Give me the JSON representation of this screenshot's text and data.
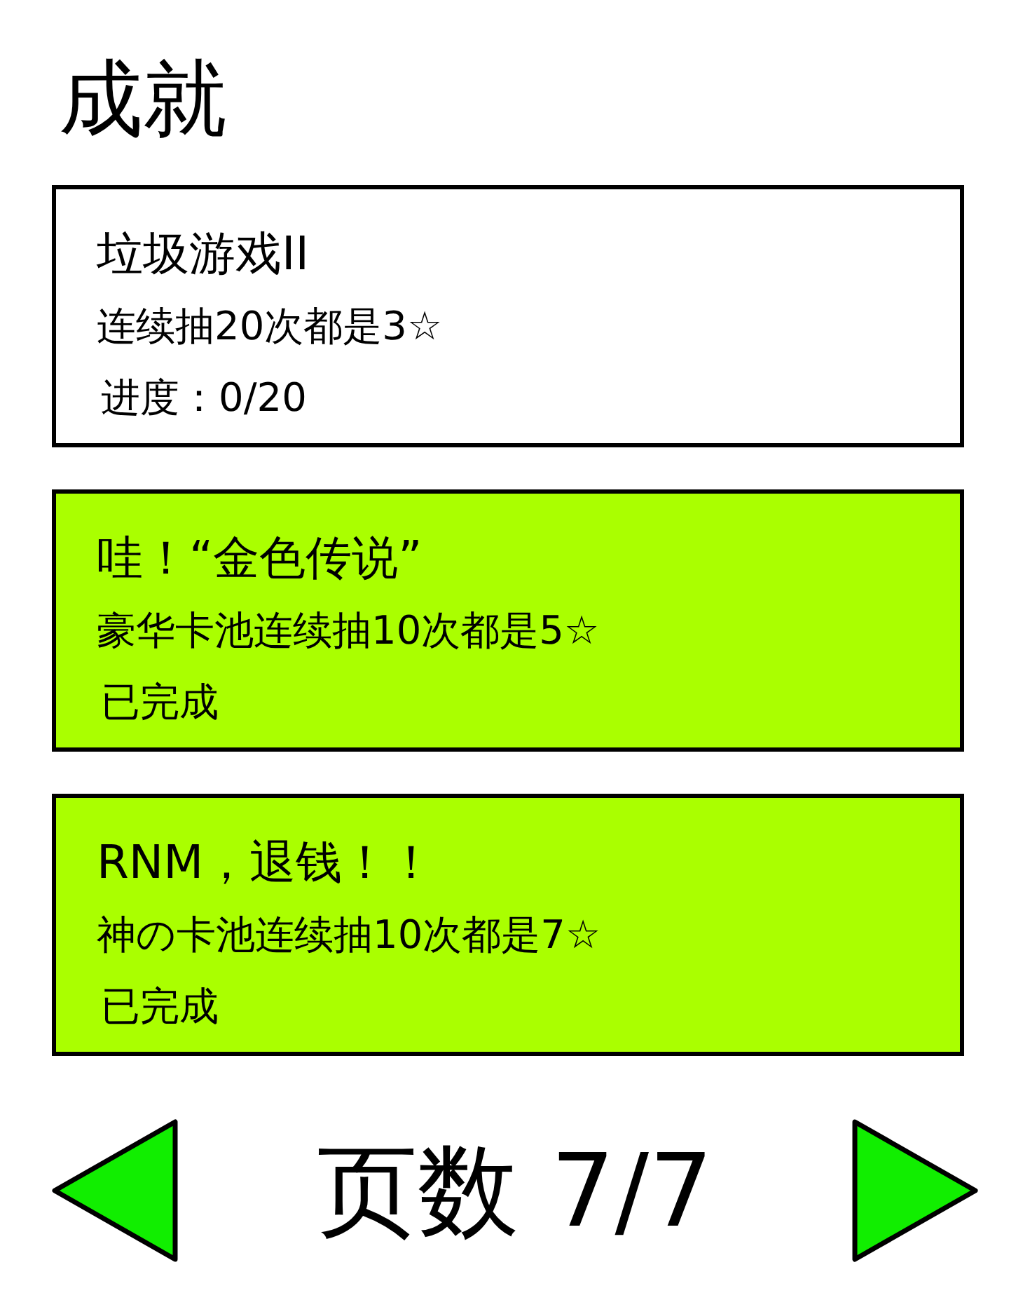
{
  "page": {
    "title": "成就"
  },
  "achievements": [
    {
      "title": "垃圾游戏II",
      "description": "连续抽20次都是3☆",
      "status": "进度：0/20",
      "completed": false
    },
    {
      "title": "哇！“金色传说”",
      "description": "豪华卡池连续抽10次都是5☆",
      "status": "已完成",
      "completed": true
    },
    {
      "title": "RNM，退钱！！",
      "description": "神の卡池连续抽10次都是7☆",
      "status": "已完成",
      "completed": true
    }
  ],
  "pagination": {
    "label": "页数 7/7"
  }
}
